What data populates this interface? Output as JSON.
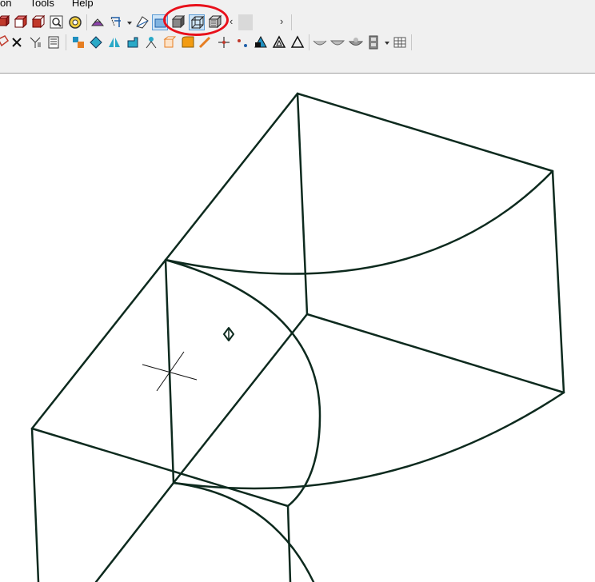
{
  "menu": {
    "items": [
      "on",
      "Tools",
      "Help"
    ]
  },
  "toolbar_row1": {
    "icons": [
      "box-red-icon",
      "box-red-alt-icon",
      "box-front-icon",
      "zoom-box-icon",
      "zoom-fit-icon",
      "paint-icon",
      "rotate-view-icon",
      "view-orient-icon",
      "shaded-view-icon",
      "solid-view-icon",
      "wireframe-view-icon",
      "hidden-lines-view-icon"
    ],
    "nav": {
      "left": "‹",
      "right": "›"
    }
  },
  "toolbar_row2": {
    "icons": [
      "sketch-icon",
      "delete-icon",
      "trim-icon",
      "dimension-icon",
      "feature-icon",
      "extrude-icon",
      "mirror-icon",
      "pattern-icon",
      "tool-icon",
      "box-feature-icon",
      "fillet-icon",
      "chamfer-icon",
      "measure-icon",
      "point-icon",
      "triangle-shaded-icon",
      "triangle-icon",
      "triangle-outline-icon",
      "shell-icon",
      "shell-alt-icon",
      "shell-3-icon",
      "filmstrip-icon",
      "table-icon"
    ]
  },
  "colors": {
    "wire": "#0d2a1e",
    "highlight": "#e8101a",
    "toolbar_bg": "#f0f0f0"
  }
}
